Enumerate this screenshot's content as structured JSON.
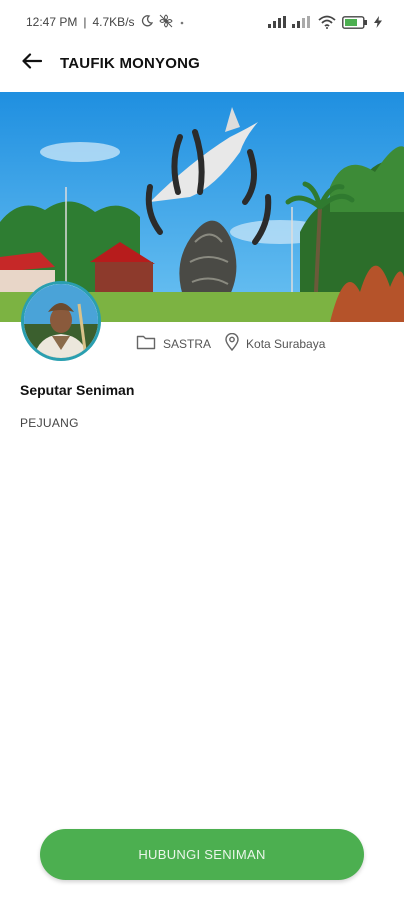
{
  "status_bar": {
    "time": "12:47 PM",
    "separator": "|",
    "speed": "4.7KB/s",
    "icons": [
      "moon-icon",
      "fan-icon",
      "dot-icon",
      "signal-icon",
      "signal-icon",
      "wifi-icon",
      "battery-icon",
      "charging-icon"
    ],
    "battery_color": "#4caf50"
  },
  "header": {
    "back_icon": "arrow-left-icon",
    "title": "TAUFIK MONYONG"
  },
  "hero": {
    "image": "suro-boyo-statue-photo"
  },
  "profile": {
    "avatar": "artist-portrait",
    "avatar_border_color": "#2a9fb0",
    "category_icon": "folder-icon",
    "category": "SASTRA",
    "location_icon": "location-pin-icon",
    "location": "Kota Surabaya"
  },
  "about": {
    "title": "Seputar Seniman",
    "body": "PEJUANG"
  },
  "cta": {
    "label": "HUBUNGI SENIMAN",
    "color": "#4caf50"
  }
}
